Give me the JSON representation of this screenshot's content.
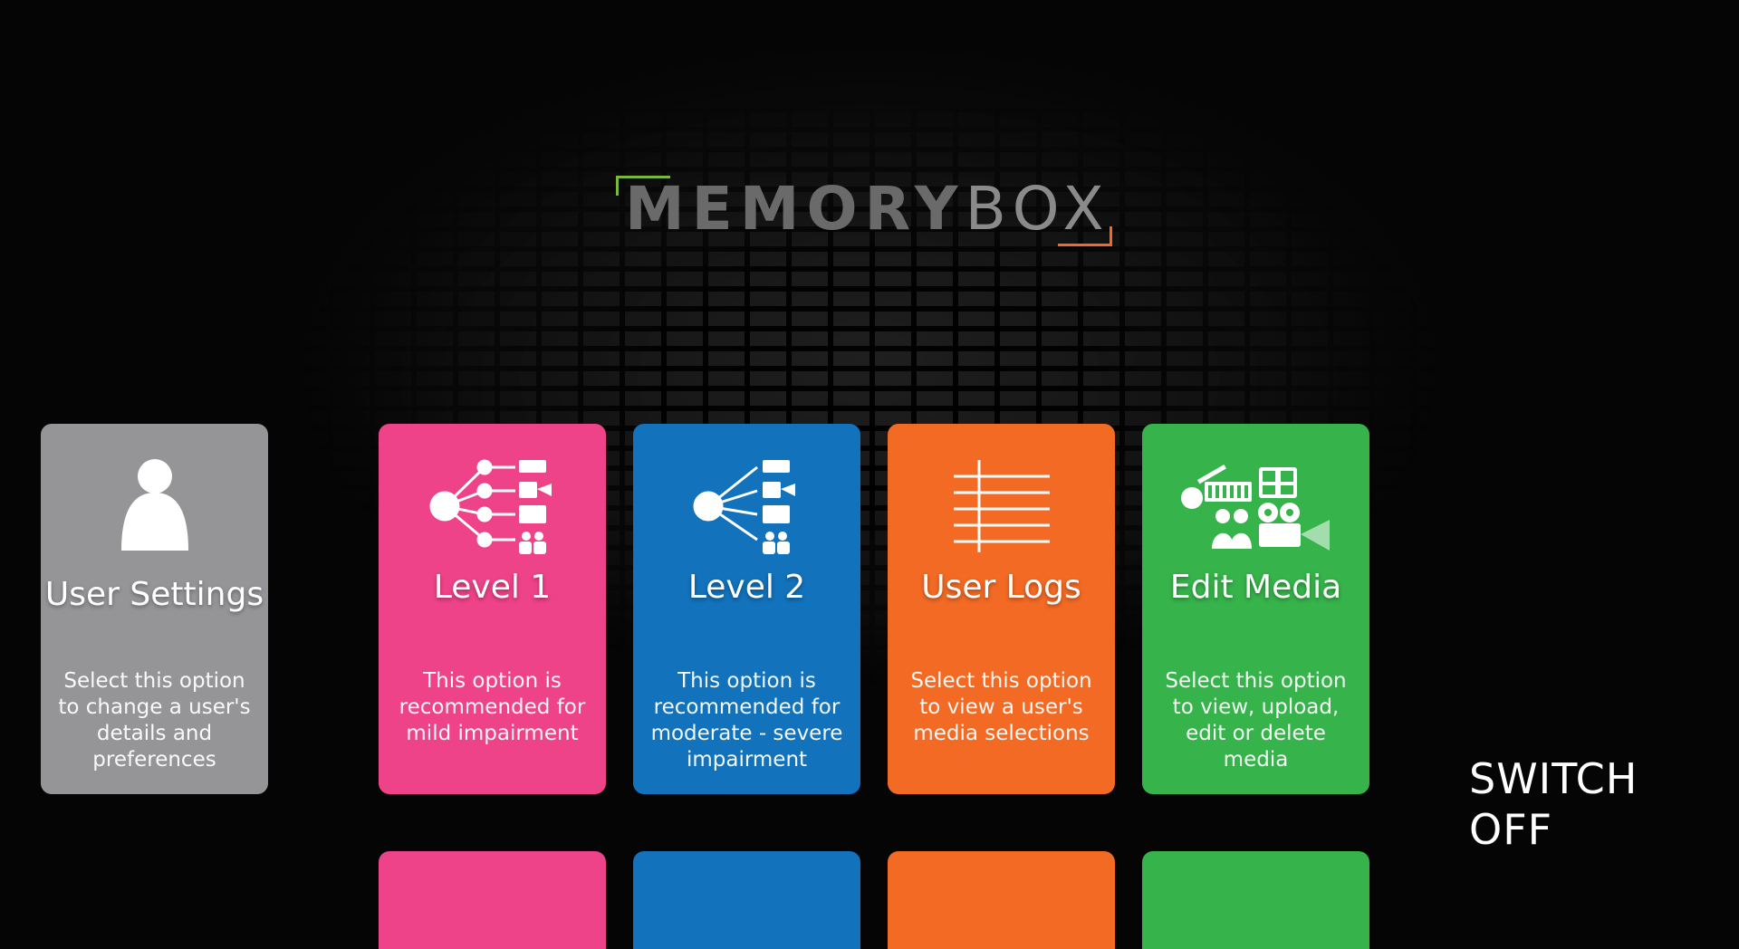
{
  "app": {
    "logo_memory": "MEMORY",
    "logo_box": "BOX",
    "logo_colors": {
      "bracket_left": "#7bb83a",
      "bracket_right": "#f26b22"
    }
  },
  "tiles": [
    {
      "key": "user-settings",
      "title": "User Settings",
      "description": "Select this option to change a user's details and preferences",
      "color": "#959598",
      "icon": "user-icon"
    },
    {
      "key": "level-1",
      "title": "Level 1",
      "description": "This option is recommended for mild impairment",
      "color": "#ee4289",
      "icon": "level-1-tree-icon"
    },
    {
      "key": "level-2",
      "title": "Level 2",
      "description": "This option is recommended for moderate - severe impairment",
      "color": "#1272bb",
      "icon": "level-2-tree-icon"
    },
    {
      "key": "user-logs",
      "title": "User Logs",
      "description": "Select this option to view a user's media selections",
      "color": "#f26a24",
      "icon": "logs-lines-icon"
    },
    {
      "key": "edit-media",
      "title": "Edit Media",
      "description": "Select this option to view, upload, edit or delete media",
      "color": "#36b34a",
      "icon": "media-collage-icon"
    }
  ],
  "switch_off": "SWITCH OFF"
}
